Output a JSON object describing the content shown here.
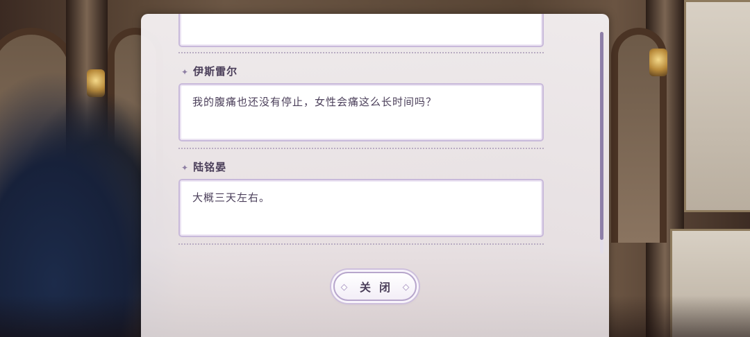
{
  "log": {
    "entries": [
      {
        "speaker": "",
        "text": ""
      },
      {
        "speaker": "伊斯雷尔",
        "text": "我的腹痛也还没有停止，女性会痛这么长时间吗？"
      },
      {
        "speaker": "陆铭晏",
        "text": "大概三天左右。"
      }
    ]
  },
  "buttons": {
    "close_label": "关闭"
  },
  "icons": {
    "speaker_marker": "✦"
  },
  "colors": {
    "accent": "#8e7fa8",
    "text": "#4b3f5a",
    "border": "#c8b9da"
  }
}
